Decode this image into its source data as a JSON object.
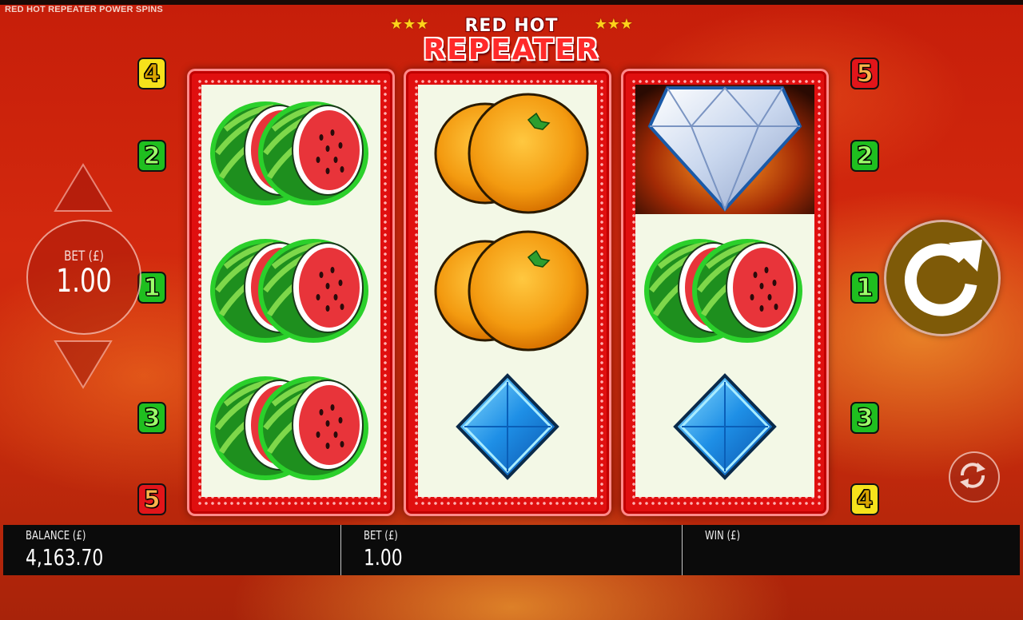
{
  "window": {
    "title": "RED HOT REPEATER POWER SPINS"
  },
  "logo": {
    "line1": "RED HOT",
    "line2": "REPEATER",
    "stars": "★★★"
  },
  "paylines": {
    "left": [
      {
        "number": "4",
        "color": "yellow"
      },
      {
        "number": "2",
        "color": "green"
      },
      {
        "number": "1",
        "color": "green"
      },
      {
        "number": "3",
        "color": "green"
      },
      {
        "number": "5",
        "color": "red"
      }
    ],
    "right": [
      {
        "number": "5",
        "color": "red"
      },
      {
        "number": "2",
        "color": "green"
      },
      {
        "number": "1",
        "color": "green"
      },
      {
        "number": "3",
        "color": "green"
      },
      {
        "number": "4",
        "color": "yellow"
      }
    ]
  },
  "reels": [
    [
      "watermelon-icon",
      "watermelon-icon",
      "watermelon-icon"
    ],
    [
      "orange-icon",
      "orange-icon",
      "blue-diamond-icon"
    ],
    [
      "white-diamond-icon",
      "watermelon-icon",
      "blue-diamond-icon"
    ]
  ],
  "bet_control": {
    "label": "BET (£)",
    "value": "1.00",
    "increase_icon": "triangle-up-icon",
    "decrease_icon": "triangle-down-icon"
  },
  "controls": {
    "spin_icon": "spin-arrow-icon",
    "autoplay_icon": "autoplay-refresh-icon"
  },
  "status_bar": {
    "balance_label": "BALANCE (£)",
    "balance_value": "4,163.70",
    "bet_label": "BET (£)",
    "bet_value": "1.00",
    "win_label": "WIN (£)",
    "win_value": ""
  },
  "colors": {
    "background": "#c61e0a",
    "reel_frame": "#e00f0f",
    "reel_bg": "#f3f8e6",
    "spin_button": "#7e5a08",
    "status_bar": "#0b0b0b"
  }
}
